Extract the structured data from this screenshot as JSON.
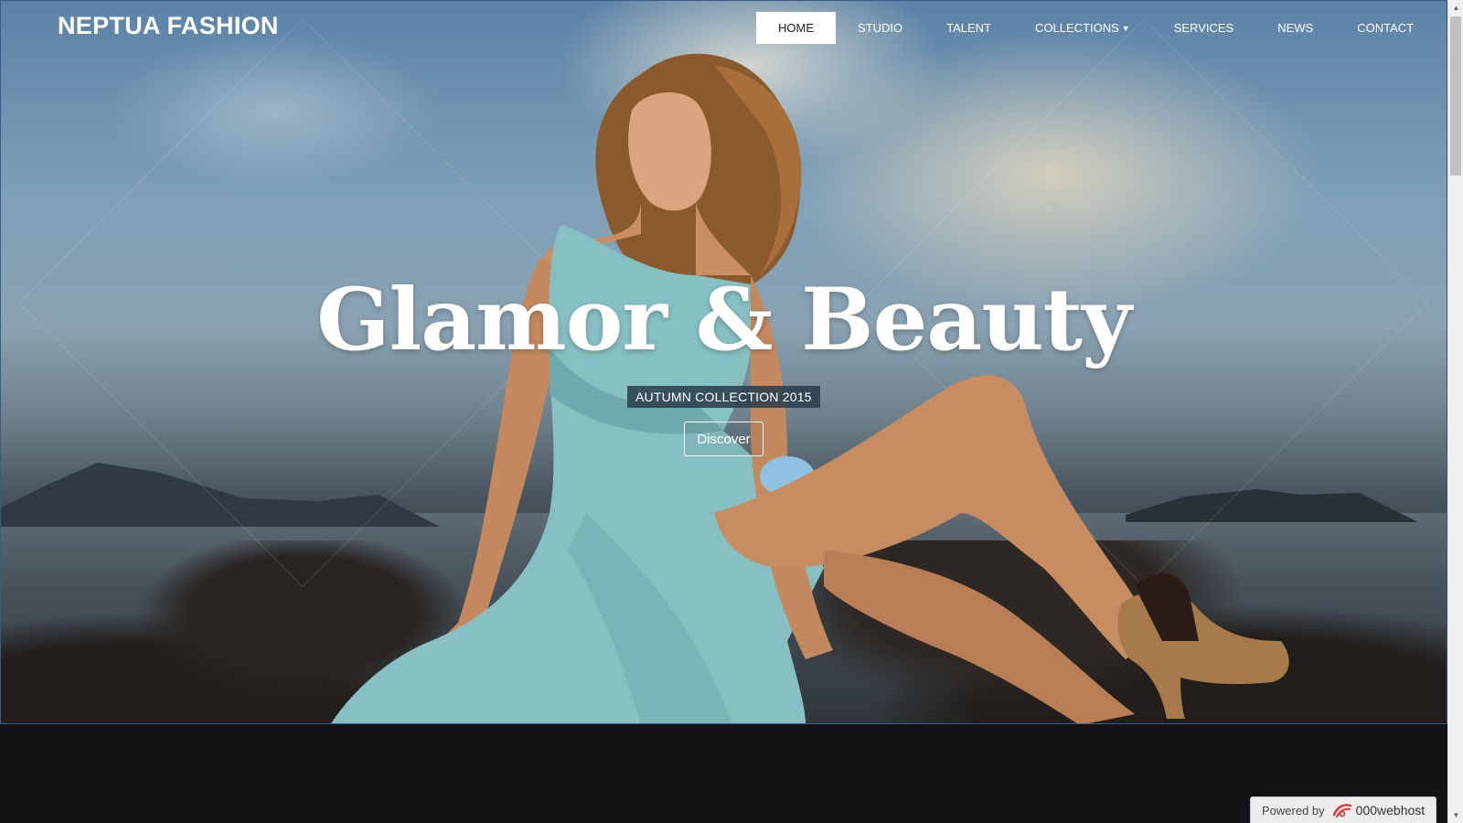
{
  "brand": "NEPTUA FASHION",
  "nav": {
    "items": [
      {
        "label": "HOME",
        "active": true
      },
      {
        "label": "STUDIO"
      },
      {
        "label": "TALENT"
      },
      {
        "label": "COLLECTIONS",
        "dropdown": true
      },
      {
        "label": "SERVICES"
      },
      {
        "label": "NEWS"
      },
      {
        "label": "CONTACT"
      }
    ]
  },
  "hero": {
    "headline": "Glamor & Beauty",
    "subtitle": "AUTUMN COLLECTION 2015",
    "cta": "Discover"
  },
  "footer_badge": {
    "prefix": "Powered by",
    "host": "000webhost",
    "icon": "000webhost-logo-icon"
  },
  "colors": {
    "nav_active_bg": "#ffffff",
    "subtitle_bg": "#283c4b",
    "dark_band": "#141416",
    "badge_logo": "#e0313a"
  }
}
